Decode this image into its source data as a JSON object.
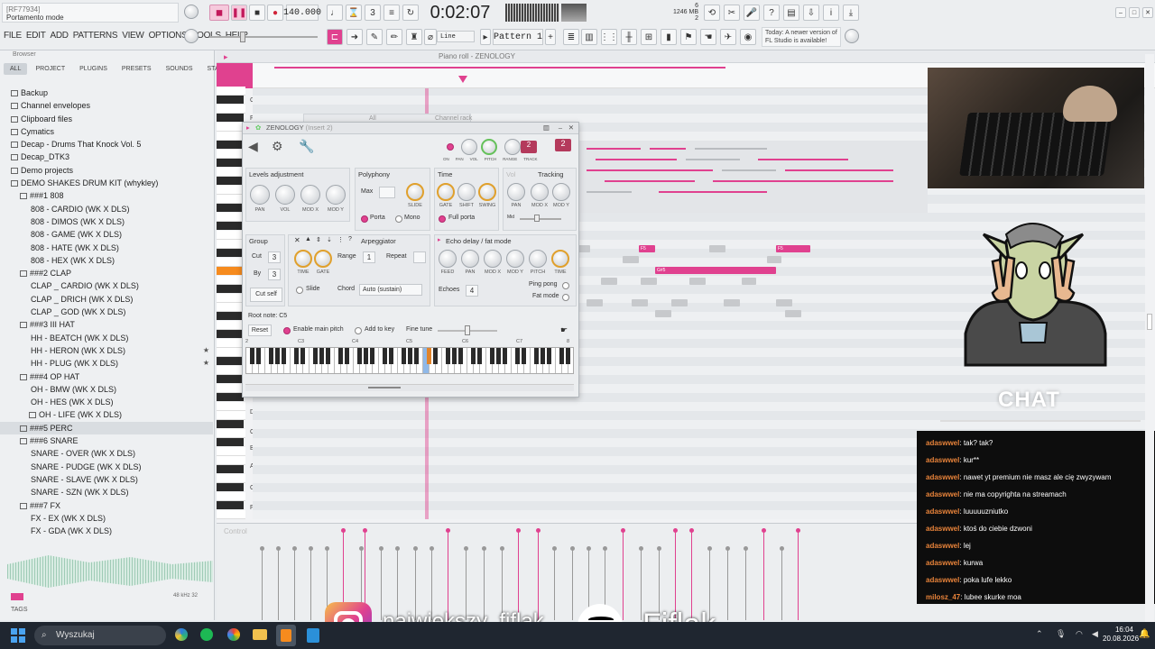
{
  "toolbar": {
    "hint_id": "[RF77934]",
    "hint_text": "Portamento mode",
    "tempo": "140.000",
    "time": "0:02:07",
    "mem_line1": "1246 MB",
    "mem_line2": "2",
    "mem_line3": "6",
    "pattern": "Pattern 1",
    "snap": "Line",
    "news": "Today: A newer version of FL Studio is available!",
    "menu": [
      "FILE",
      "EDIT",
      "ADD",
      "PATTERNS",
      "VIEW",
      "OPTIONS",
      "TOOLS",
      "HELP"
    ]
  },
  "browser": {
    "title": "Browser",
    "tabs": [
      "ALL",
      "PROJECT",
      "PLUGINS",
      "PRESETS",
      "SOUNDS",
      "STARRED"
    ],
    "items": [
      {
        "label": "Backup",
        "level": 0,
        "folder": true
      },
      {
        "label": "Channel envelopes",
        "level": 0,
        "folder": true
      },
      {
        "label": "Clipboard files",
        "level": 0,
        "folder": true
      },
      {
        "label": "Cymatics",
        "level": 0,
        "folder": true
      },
      {
        "label": "Decap - Drums That Knock Vol. 5",
        "level": 0,
        "folder": true
      },
      {
        "label": "Decap_DTK3",
        "level": 0,
        "folder": true
      },
      {
        "label": "Demo projects",
        "level": 0,
        "folder": true
      },
      {
        "label": "DEMO SHAKES DRUM KIT (whykley)",
        "level": 0,
        "folder": true
      },
      {
        "label": "###1 808",
        "level": 1,
        "folder": true
      },
      {
        "label": "808 - CARDIO (WK X DLS)",
        "level": 2
      },
      {
        "label": "808 - DIMOS (WK X DLS)",
        "level": 2
      },
      {
        "label": "808 - GAME (WK X DLS)",
        "level": 2
      },
      {
        "label": "808 - HATE (WK X DLS)",
        "level": 2
      },
      {
        "label": "808 - HEX (WK X DLS)",
        "level": 2
      },
      {
        "label": "###2 CLAP",
        "level": 1,
        "folder": true
      },
      {
        "label": "CLAP _ CARDIO (WK X DLS)",
        "level": 2
      },
      {
        "label": "CLAP _ DRICH (WK X DLS)",
        "level": 2
      },
      {
        "label": "CLAP _ GOD (WK X DLS)",
        "level": 2
      },
      {
        "label": "###3 III HAT",
        "level": 1,
        "folder": true
      },
      {
        "label": "HH - BEATCH (WK X DLS)",
        "level": 2
      },
      {
        "label": "HH - HERON (WK X DLS)",
        "level": 2,
        "star": true
      },
      {
        "label": "HH - PLUG (WK X DLS)",
        "level": 2,
        "star": true
      },
      {
        "label": "###4 OP HAT",
        "level": 1,
        "folder": true
      },
      {
        "label": "OH - BMW (WK X DLS)",
        "level": 2
      },
      {
        "label": "OH - HES (WK X DLS)",
        "level": 2
      },
      {
        "label": "OH - LIFE (WK X DLS)",
        "level": 2,
        "folder": true
      },
      {
        "label": "###5 PERC",
        "level": 1,
        "folder": true,
        "hl": true
      },
      {
        "label": "###6 SNARE",
        "level": 1,
        "folder": true
      },
      {
        "label": "SNARE - OVER (WK X DLS)",
        "level": 2
      },
      {
        "label": "SNARE - PUDGE (WK X DLS)",
        "level": 2
      },
      {
        "label": "SNARE - SLAVE (WK X DLS)",
        "level": 2
      },
      {
        "label": "SNARE - SZN (WK X DLS)",
        "level": 2
      },
      {
        "label": "###7 FX",
        "level": 1,
        "folder": true
      },
      {
        "label": "FX - EX (WK X DLS)",
        "level": 2
      },
      {
        "label": "FX - GDA (WK X DLS)",
        "level": 2
      }
    ],
    "sample_info": "48 kHz 32",
    "tags": "TAGS"
  },
  "pianoroll": {
    "title": "Piano roll - ZENOLOGY",
    "channel_rack": "Channel rack",
    "channel_rack_filter": "All",
    "control": "Control",
    "key_labels": [
      "G6",
      "F6",
      "D4",
      "C4",
      "B3",
      "A3",
      "G3",
      "F3"
    ],
    "pink_note_labels": [
      "F5",
      "F5",
      "G#5"
    ]
  },
  "zenology": {
    "title": "ZENOLOGY",
    "insert": "(Insert 2)",
    "header_knobs": [
      "ON",
      "PAN",
      "VOL",
      "PITCH",
      "RANGE",
      "TRACK"
    ],
    "range_value": "2",
    "track_value": "2",
    "levels": {
      "title": "Levels adjustment",
      "knobs": [
        "PAN",
        "VOL",
        "MOD X",
        "MOD Y"
      ]
    },
    "polyphony": {
      "title": "Polyphony",
      "max_label": "Max",
      "slide": "SLIDE",
      "porta": "Porta",
      "mono": "Mono"
    },
    "time": {
      "title": "Time",
      "knobs": [
        "GATE",
        "SHIFT",
        "SWING"
      ],
      "full_porta": "Full porta"
    },
    "vol_tracking": {
      "vol": "Vol",
      "tracking": "Tracking",
      "knobs": [
        "PAN",
        "MOD X",
        "MOD Y"
      ],
      "mid": "Mid"
    },
    "group": {
      "title": "Group",
      "cut_label": "Cut",
      "cut": "3",
      "by_label": "By",
      "by": "3",
      "cut_self": "Cut self"
    },
    "arp": {
      "title": "Arpeggiator",
      "knobs": [
        "TIME",
        "GATE"
      ],
      "range_label": "Range",
      "range": "1",
      "repeat_label": "Repeat",
      "slide": "Slide",
      "chord_label": "Chord",
      "chord": "Auto (sustain)"
    },
    "echo": {
      "title": "Echo delay / fat mode",
      "knobs": [
        "FEED",
        "PAN",
        "MOD X",
        "MOD Y",
        "PITCH",
        "TIME"
      ],
      "echoes_label": "Echoes",
      "echoes": "4",
      "ping_pong": "Ping pong",
      "fat_mode": "Fat mode"
    },
    "root": {
      "title": "Root note: C5",
      "reset": "Reset",
      "enable": "Enable main pitch",
      "add_to_key": "Add to key",
      "fine_tune": "Fine tune"
    },
    "octaves": [
      "2",
      "C3",
      "C4",
      "C5",
      "C6",
      "C7",
      "8"
    ]
  },
  "overlay": {
    "chat_title": "CHAT",
    "instagram": "najwiekszy_fiflak",
    "spotify": "Fiflak"
  },
  "chat": [
    {
      "user": "adaswwel",
      "msg": "tak? tak?"
    },
    {
      "user": "adaswwel",
      "msg": "kur**"
    },
    {
      "user": "adaswwel",
      "msg": "nawet yt premium nie masz ale cię zwyzywam"
    },
    {
      "user": "adaswwel",
      "msg": "nie ma copyrighta na streamach"
    },
    {
      "user": "adaswwel",
      "msg": "luuuuuzniutko"
    },
    {
      "user": "adaswwel",
      "msg": "ktoś do ciebie dzwoni"
    },
    {
      "user": "adaswwel",
      "msg": "lej"
    },
    {
      "user": "adaswwel",
      "msg": "kurwa"
    },
    {
      "user": "adaswwel",
      "msg": "poka lufe lekko"
    },
    {
      "user": "milosz_47",
      "msg": "lubee skurke moa"
    }
  ],
  "taskbar": {
    "search": "Wyszukaj",
    "time": "16:04",
    "date": "20.08.2026"
  },
  "colors": {
    "accent": "#e0418f",
    "knob_orange": "#e0a02c",
    "chat_user": "#e8833a"
  }
}
